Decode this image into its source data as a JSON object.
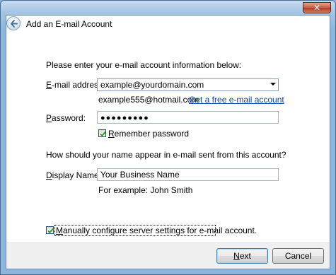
{
  "window": {
    "close_glyph": "✕"
  },
  "header": {
    "title": "Add an E-mail Account",
    "back_icon": "back-arrow-icon"
  },
  "form": {
    "intro": "Please enter your e-mail account information below:",
    "email": {
      "label_accel": "E",
      "label_rest": "-mail address:",
      "value": "example@yourdomain.com",
      "example": "example555@hotmail.com",
      "free_link": "Get a free e-mail account"
    },
    "password": {
      "label_accel": "P",
      "label_rest": "assword:",
      "masked_value": "●●●●●●●●●",
      "remember_accel": "R",
      "remember_rest": "emember password",
      "remember_checked": true
    },
    "name_question": "How should your name appear in e-mail sent from this account?",
    "display_name": {
      "label_accel": "D",
      "label_rest": "isplay Name:",
      "value": "Your Business Name",
      "example": "For example: John Smith"
    },
    "manual": {
      "label_accel": "M",
      "label_rest": "anually configure server settings for e-mail account.",
      "checked": true
    }
  },
  "footer": {
    "next_accel": "N",
    "next_rest": "ext",
    "cancel_label": "Cancel"
  },
  "colors": {
    "link": "#0645ad",
    "title_bar": "#8db5dd",
    "close_button": "#c45a44"
  }
}
